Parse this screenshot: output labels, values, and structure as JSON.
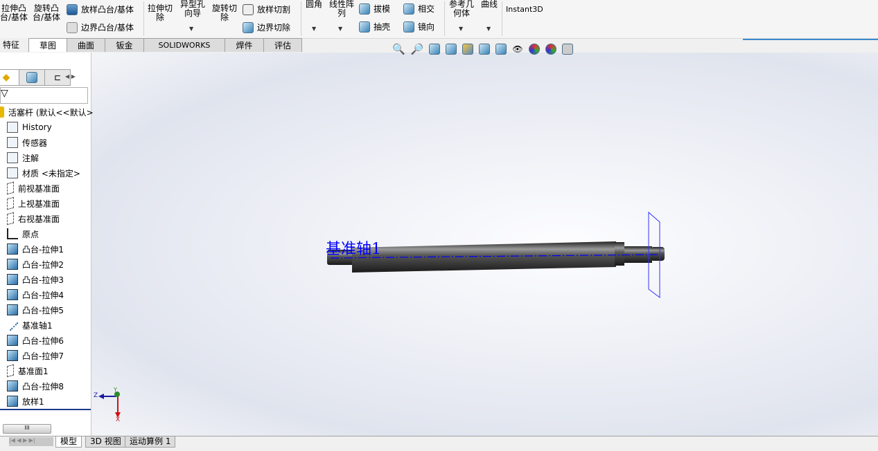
{
  "ribbon": {
    "extrude_boss": "拉伸凸\n台/基体",
    "revolve_boss": "旋转凸\n台/基体",
    "loft_boss": "放样凸台/基体",
    "boundary_boss": "边界凸台/基体",
    "extrude_cut": "拉伸切\n除",
    "hole_wizard": "异型孔\n向导",
    "revolve_cut": "旋转切\n除",
    "loft_cut": "放样切割",
    "boundary_cut": "边界切除",
    "fillet": "圆角",
    "linear_pattern": "线性阵\n列",
    "draft": "拔模",
    "intersect": "相交",
    "shell": "抽壳",
    "mirror": "镜向",
    "ref_geometry": "参考几\n何体",
    "curves": "曲线",
    "instant3d": "Instant3D"
  },
  "tabs": [
    "特征",
    "草图",
    "曲面",
    "钣金",
    "SOLIDWORKS MBD",
    "焊件(D)",
    "评估"
  ],
  "active_tab": "草图",
  "tree": {
    "root": "活塞杆 (默认<<默认>",
    "items": [
      "History",
      "传感器",
      "注解",
      "材质 <未指定>",
      "前视基准面",
      "上视基准面",
      "右视基准面",
      "原点",
      "凸台-拉伸1",
      "凸台-拉伸2",
      "凸台-拉伸3",
      "凸台-拉伸4",
      "凸台-拉伸5",
      "基准轴1",
      "凸台-拉伸6",
      "凸台-拉伸7",
      "基准面1",
      "凸台-拉伸8",
      "放样1"
    ]
  },
  "viewport": {
    "axis_label": "基准轴1",
    "triad": {
      "z": "Z",
      "y": "Y",
      "x": "X"
    },
    "accent": "#0000ff"
  },
  "bottom_tabs": [
    "模型",
    "3D 视图",
    "运动算例 1"
  ],
  "active_bottom_tab": "模型"
}
